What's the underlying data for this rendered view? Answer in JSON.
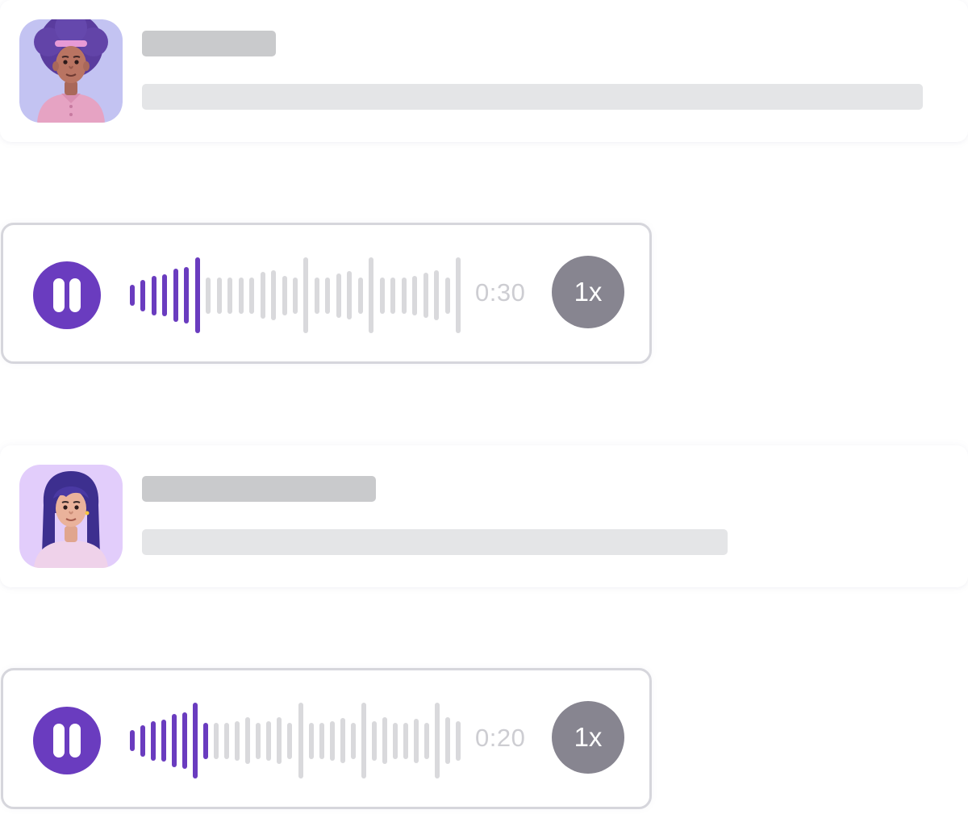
{
  "colors": {
    "accent": "#6a3cbf",
    "wave_played": "#6a3cbf",
    "wave_unplayed": "#d9d9dc",
    "speed_button": "#878590",
    "skeleton_dark": "#c9cacc",
    "skeleton_light": "#e4e5e7"
  },
  "contacts": [
    {
      "avatar": "avatar-man-afro-icon",
      "avatar_bg": "#c3c3f2"
    },
    {
      "avatar": "avatar-woman-long-hair-icon",
      "avatar_bg": "#e2cdfb"
    }
  ],
  "players": [
    {
      "state": "playing",
      "control_icon": "pause-icon",
      "duration": "0:30",
      "speed": "1x",
      "progress": 0.24,
      "waveform_levels": [
        0.28,
        0.42,
        0.52,
        0.55,
        0.7,
        0.74,
        1.0,
        0.48,
        0.48,
        0.48,
        0.48,
        0.48,
        0.62,
        0.66,
        0.52,
        0.48,
        1.0,
        0.48,
        0.48,
        0.58,
        0.64,
        0.48,
        1.0,
        0.48,
        0.48,
        0.48,
        0.52,
        0.6,
        0.66,
        0.48,
        1.0
      ]
    },
    {
      "state": "playing",
      "control_icon": "pause-icon",
      "duration": "0:20",
      "speed": "1x",
      "progress": 0.24,
      "waveform_levels": [
        0.28,
        0.42,
        0.52,
        0.55,
        0.7,
        0.74,
        1.0,
        0.48,
        0.48,
        0.48,
        0.52,
        0.62,
        0.48,
        0.52,
        0.62,
        0.48,
        1.0,
        0.48,
        0.48,
        0.52,
        0.6,
        0.48,
        1.0,
        0.52,
        0.62,
        0.48,
        0.48,
        0.58,
        0.48,
        1.0,
        0.62,
        0.52
      ]
    }
  ]
}
